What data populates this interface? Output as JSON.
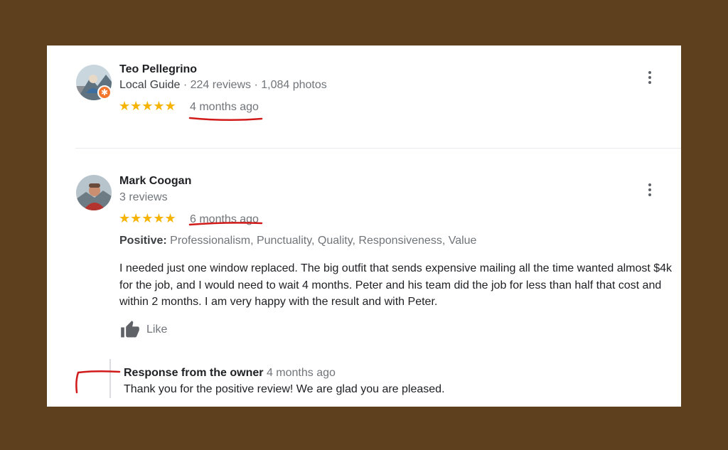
{
  "reviews": [
    {
      "name": "Teo Pellegrino",
      "badge": "Local Guide",
      "stats": "224 reviews · 1,084 photos",
      "stars": "★★★★★",
      "date": "4 months ago"
    },
    {
      "name": "Mark Coogan",
      "stats": "3 reviews",
      "stars": "★★★★★",
      "date": "6 months ago",
      "positive_label": "Positive:",
      "positive_values": "Professionalism, Punctuality, Quality, Responsiveness, Value",
      "text": "I needed just one window replaced.  The big outfit that sends expensive mailing all the time wanted almost $4k for the job, and I would need to wait 4 months.  Peter and his team did the job for less than half that cost and within 2 months.  I am very happy with the result and with Peter.",
      "like_label": "Like",
      "owner_response": {
        "title": "Response from the owner",
        "date": "4 months ago",
        "text": "Thank you for the positive review! We are glad you are pleased."
      }
    }
  ],
  "colors": {
    "background": "#5e3f1e",
    "star": "#f6b400",
    "annotation": "#d11a1a",
    "local_guide_badge": "#f2762e"
  },
  "icons": {
    "menu": "more-vert-icon",
    "like": "thumbs-up-icon",
    "badge": "local-guide-star-icon"
  }
}
